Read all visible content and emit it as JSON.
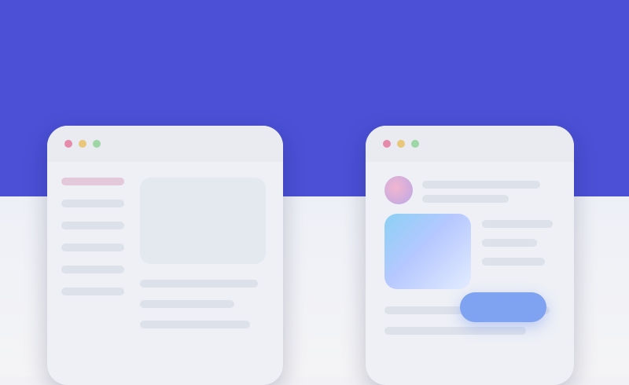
{
  "colors": {
    "hero_background": "#4b50d6",
    "page_background": "#f2f2f6",
    "card_background": "#eef0f5",
    "accent_pink": "#e58aa8",
    "accent_blue": "#7fa3f0",
    "tile_gradient_start": "#8bd0f5",
    "tile_gradient_end": "#e3ecff"
  },
  "icons": {
    "window_close": "close-dot-icon",
    "window_minimize": "minimize-dot-icon",
    "window_maximize": "maximize-dot-icon",
    "avatar": "avatar-icon"
  },
  "primary_button": {
    "label": ""
  }
}
